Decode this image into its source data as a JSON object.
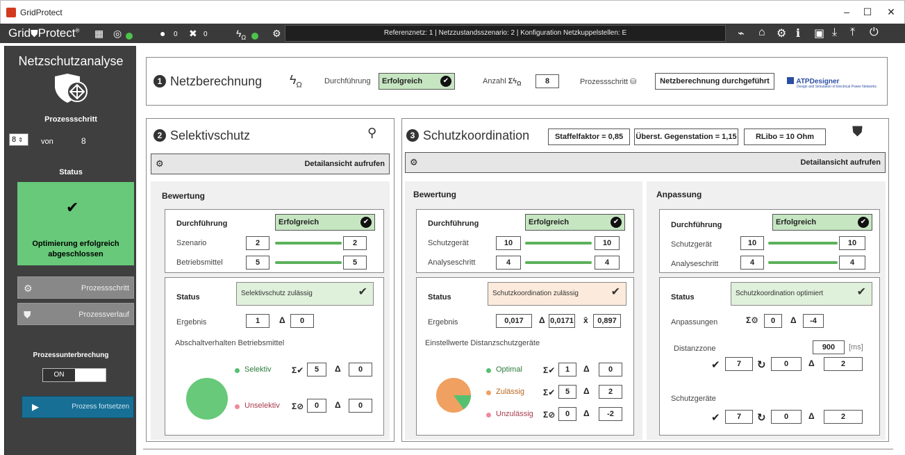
{
  "window": {
    "title": "GridProtect",
    "minimize": "–",
    "maximize": "☐",
    "close": "✕"
  },
  "toolbar": {
    "logo_a": "Grid",
    "logo_b": "Protect",
    "logo_tm": "®",
    "warn_count": "0",
    "error_count": "0",
    "status_text": "Referenznetz: 1 | Netzzustandsszenario: 2 | Konfiguration Netzkuppelstellen: E"
  },
  "sidebar": {
    "title": "Netzschutzanalyse",
    "step_label": "Prozessschritt",
    "step_value": "8",
    "step_von": "von",
    "step_total": "8",
    "status_label": "Status",
    "status_text": "Optimierung erfolgreich abgeschlossen",
    "btn_step": "Prozessschritt",
    "btn_history": "Prozessverlauf",
    "interrupt_label": "Prozessunterbrechung",
    "toggle_on": "ON",
    "continue_btn": "Prozess fortsetzen"
  },
  "netz": {
    "num": "1",
    "title": "Netzberechnung",
    "durch_label": "Durchführung",
    "durch_value": "Erfolgreich",
    "anzahl_label": "Anzahl",
    "anzahl_value": "8",
    "prozess_label": "Prozessschritt",
    "prozess_value": "Netzberechnung durchgeführt",
    "atp_title": "ATPDesigner",
    "atp_sub": "Design and Simulation of Electrical Power Networks"
  },
  "selektiv": {
    "num": "2",
    "title": "Selektivschutz",
    "detail": "Detailansicht aufrufen",
    "bewertung": "Bewertung",
    "durch_label": "Durchführung",
    "durch_value": "Erfolgreich",
    "row1_label": "Szenario",
    "row1_a": "2",
    "row1_b": "2",
    "row2_label": "Betriebsmittel",
    "row2_a": "5",
    "row2_b": "5",
    "status_label": "Status",
    "status_value": "Selektivschutz zulässig",
    "ergebnis_label": "Ergebnis",
    "ergebnis_value": "1",
    "ergebnis_delta": "0",
    "abschalt_label": "Abschaltverhalten Betriebsmittel",
    "leg1": "Selektiv",
    "leg1_v": "5",
    "leg1_d": "0",
    "leg2": "Unselektiv",
    "leg2_v": "0",
    "leg2_d": "0"
  },
  "koord": {
    "num": "3",
    "title": "Schutzkoordination",
    "staffel": "Staffelfaktor = 0,85",
    "uberst": "Überst. Gegenstation = 1,15",
    "rlibo": "RLibo = 10 Ohm",
    "detail": "Detailansicht aufrufen",
    "bewertung": "Bewertung",
    "durch_label": "Durchführung",
    "durch_value": "Erfolgreich",
    "row1_label": "Schutzgerät",
    "row1_a": "10",
    "row1_b": "10",
    "row2_label": "Analyseschritt",
    "row2_a": "4",
    "row2_b": "4",
    "status_label": "Status",
    "status_value": "Schutzkoordination zulässig",
    "ergebnis_label": "Ergebnis",
    "ergebnis_value": "0,017",
    "ergebnis_delta": "0,0171",
    "ergebnis_mean": "0,897",
    "einstell_label": "Einstellwerte Distanzschutzgeräte",
    "leg1": "Optimal",
    "leg1_v": "1",
    "leg1_d": "0",
    "leg2": "Zulässig",
    "leg2_v": "5",
    "leg2_d": "2",
    "leg3": "Unzulässig",
    "leg3_v": "0",
    "leg3_d": "-2",
    "anpassung": "Anpassung",
    "a_durch_label": "Durchführung",
    "a_durch_value": "Erfolgreich",
    "a_row1_label": "Schutzgerät",
    "a_row1_a": "10",
    "a_row1_b": "10",
    "a_row2_label": "Analyseschritt",
    "a_row2_a": "4",
    "a_row2_b": "4",
    "a_status_value": "Schutzkoordination optimiert",
    "a_anpass_label": "Anpassungen",
    "a_anpass_v": "0",
    "a_anpass_d": "-4",
    "distanz_label": "Distanzzone",
    "distanz_value": "900",
    "distanz_unit": "[ms]",
    "dz_ok": "7",
    "dz_cycle": "0",
    "dz_delta": "2",
    "schutz_label": "Schutzgeräte",
    "sg_ok": "7",
    "sg_cycle": "0",
    "sg_delta": "2"
  },
  "colors": {
    "green": "#67c979",
    "pie_orange": "#f0a060",
    "pie_green": "#55c170",
    "dot_pink": "#f08a9a"
  }
}
